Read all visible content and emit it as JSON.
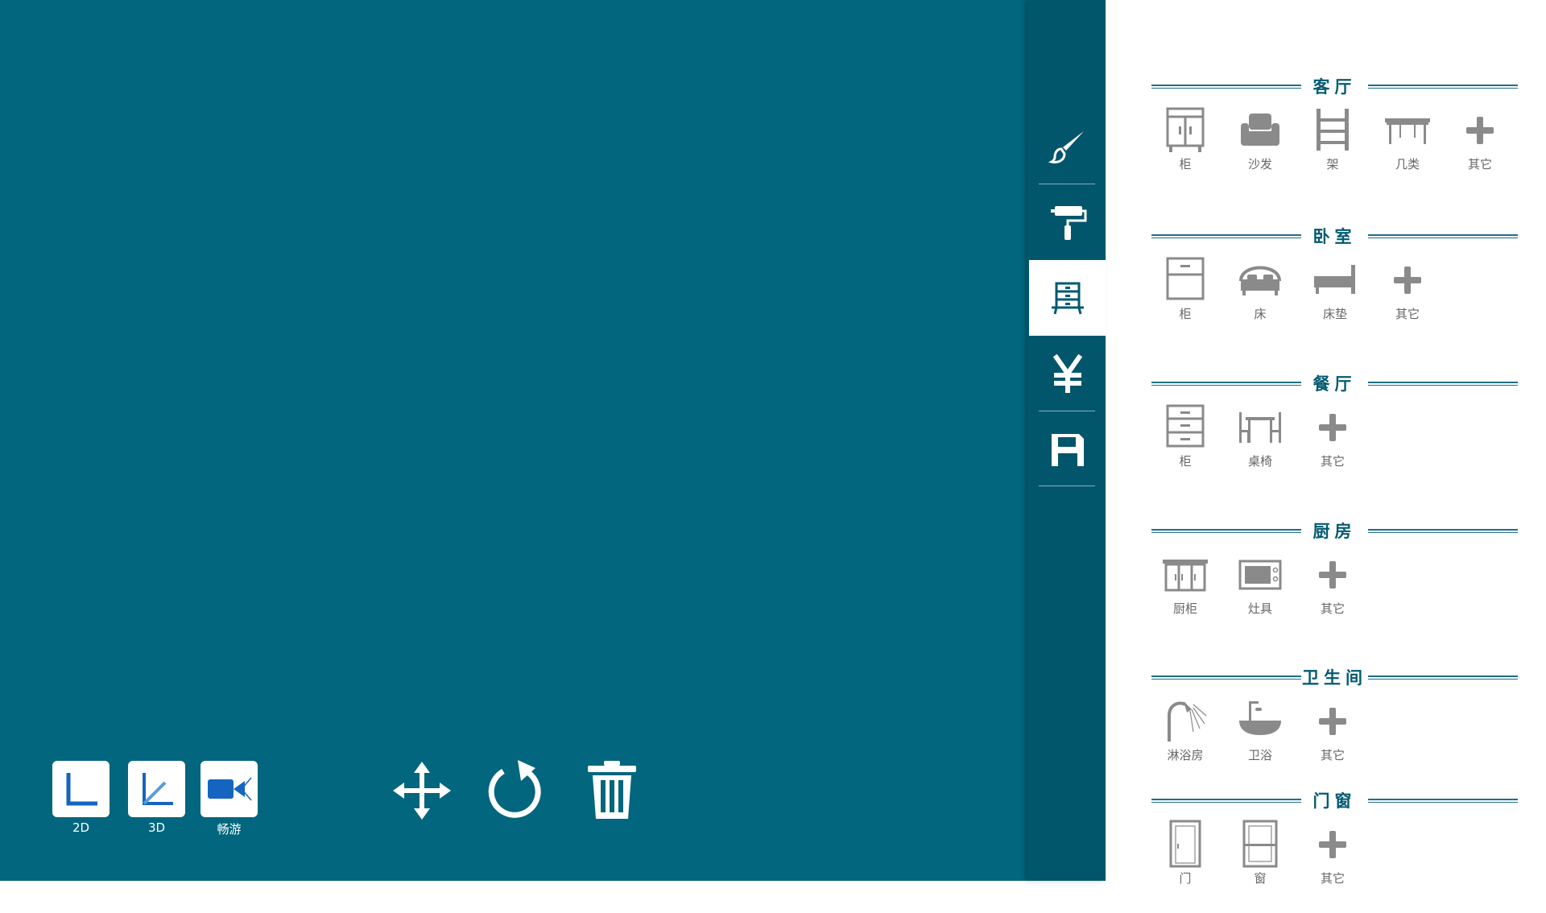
{
  "side_toolbar": {
    "tools": [
      {
        "id": "brush",
        "icon": "paint-brush-icon",
        "active": false
      },
      {
        "id": "roller",
        "icon": "paint-roller-icon",
        "active": false
      },
      {
        "id": "furniture",
        "icon": "furniture-cabinet-icon",
        "active": true
      },
      {
        "id": "price",
        "icon": "yen-icon",
        "active": false
      },
      {
        "id": "save",
        "icon": "save-icon",
        "active": false
      }
    ]
  },
  "view_modes": [
    {
      "label": "2D",
      "icon": "2d-view-icon"
    },
    {
      "label": "3D",
      "icon": "3d-view-icon"
    },
    {
      "label": "畅游",
      "icon": "camera-tour-icon"
    }
  ],
  "actions": [
    {
      "name": "move",
      "icon": "move-icon"
    },
    {
      "name": "rotate",
      "icon": "rotate-icon"
    },
    {
      "name": "delete",
      "icon": "trash-icon"
    }
  ],
  "catalog": {
    "sections": [
      {
        "title": "客厅",
        "items": [
          {
            "label": "柜",
            "icon": "cabinet-icon"
          },
          {
            "label": "沙发",
            "icon": "sofa-icon"
          },
          {
            "label": "架",
            "icon": "shelf-icon"
          },
          {
            "label": "几类",
            "icon": "table-icon"
          },
          {
            "label": "其它",
            "icon": "plus-icon"
          }
        ]
      },
      {
        "title": "卧室",
        "items": [
          {
            "label": "柜",
            "icon": "wardrobe-icon"
          },
          {
            "label": "床",
            "icon": "bed-icon"
          },
          {
            "label": "床垫",
            "icon": "mattress-icon"
          },
          {
            "label": "其它",
            "icon": "plus-icon"
          }
        ]
      },
      {
        "title": "餐厅",
        "items": [
          {
            "label": "柜",
            "icon": "drawer-cabinet-icon"
          },
          {
            "label": "桌椅",
            "icon": "dining-set-icon"
          },
          {
            "label": "其它",
            "icon": "plus-icon"
          }
        ]
      },
      {
        "title": "厨房",
        "items": [
          {
            "label": "厨柜",
            "icon": "kitchen-cabinet-icon"
          },
          {
            "label": "灶具",
            "icon": "microwave-icon"
          },
          {
            "label": "其它",
            "icon": "plus-icon"
          }
        ]
      },
      {
        "title": "卫生间",
        "items": [
          {
            "label": "淋浴房",
            "icon": "shower-icon"
          },
          {
            "label": "卫浴",
            "icon": "basin-icon"
          },
          {
            "label": "其它",
            "icon": "plus-icon"
          }
        ]
      },
      {
        "title": "门窗",
        "items": [
          {
            "label": "门",
            "icon": "door-icon"
          },
          {
            "label": "窗",
            "icon": "window-icon"
          },
          {
            "label": "其它",
            "icon": "plus-icon"
          }
        ]
      }
    ]
  },
  "colors": {
    "canvas": "#01667e",
    "toolbar": "#02566b",
    "accent": "#035a71",
    "icon_gray": "#8a8a8a"
  }
}
